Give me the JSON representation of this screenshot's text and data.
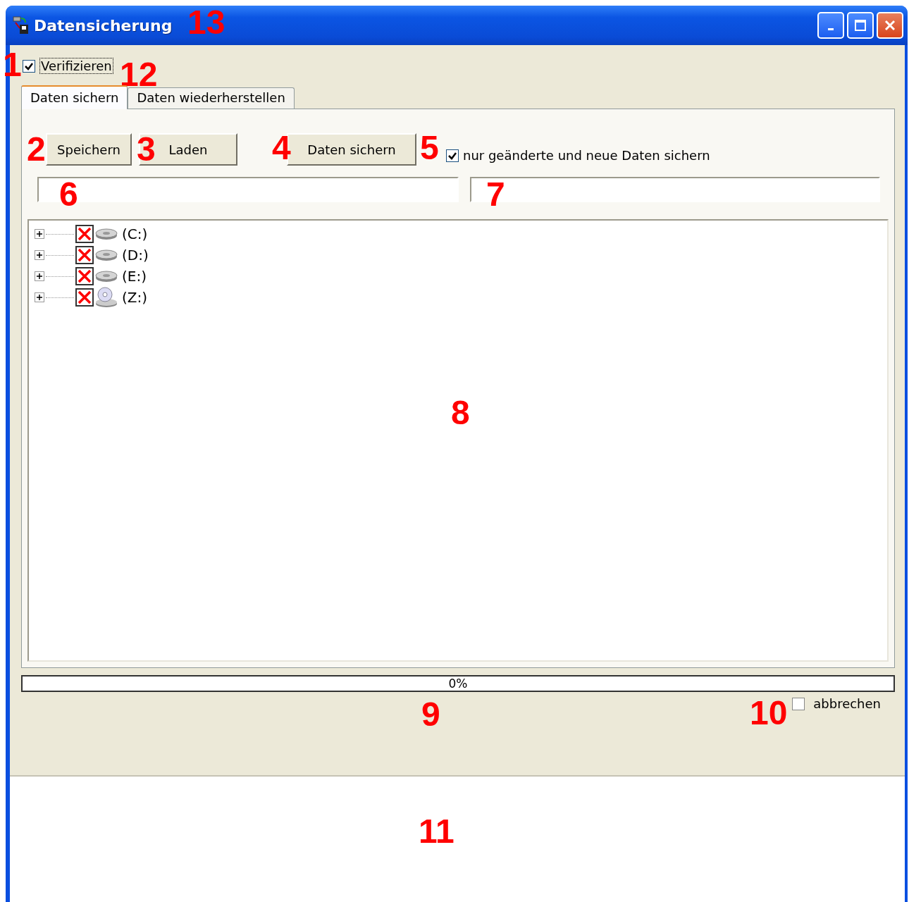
{
  "window": {
    "title": "Datensicherung"
  },
  "verify": {
    "label": "Verifizieren",
    "checked": true
  },
  "tabs": [
    {
      "label": "Daten sichern",
      "selected": true
    },
    {
      "label": "Daten wiederherstellen",
      "selected": false
    }
  ],
  "buttons": [
    "Speichern",
    "Laden",
    "Daten sichern"
  ],
  "only_changed": {
    "label": "nur geänderte und neue Daten sichern",
    "checked": true
  },
  "tree": [
    {
      "label": "(C:)",
      "kind": "disk",
      "excluded": true,
      "expanded": false
    },
    {
      "label": "(D:)",
      "kind": "disk",
      "excluded": true,
      "expanded": false
    },
    {
      "label": "(E:)",
      "kind": "disk",
      "excluded": true,
      "expanded": false
    },
    {
      "label": "(Z:)",
      "kind": "cdrom",
      "excluded": true,
      "expanded": false
    }
  ],
  "progress": {
    "level": 0,
    "reading": "0%"
  },
  "cancel": {
    "label": "abbrechen",
    "checked": false
  },
  "callouts": [
    "1",
    "2",
    "3",
    "4",
    "5",
    "6",
    "7",
    "8",
    "9",
    "10",
    "11",
    "12",
    "13"
  ]
}
